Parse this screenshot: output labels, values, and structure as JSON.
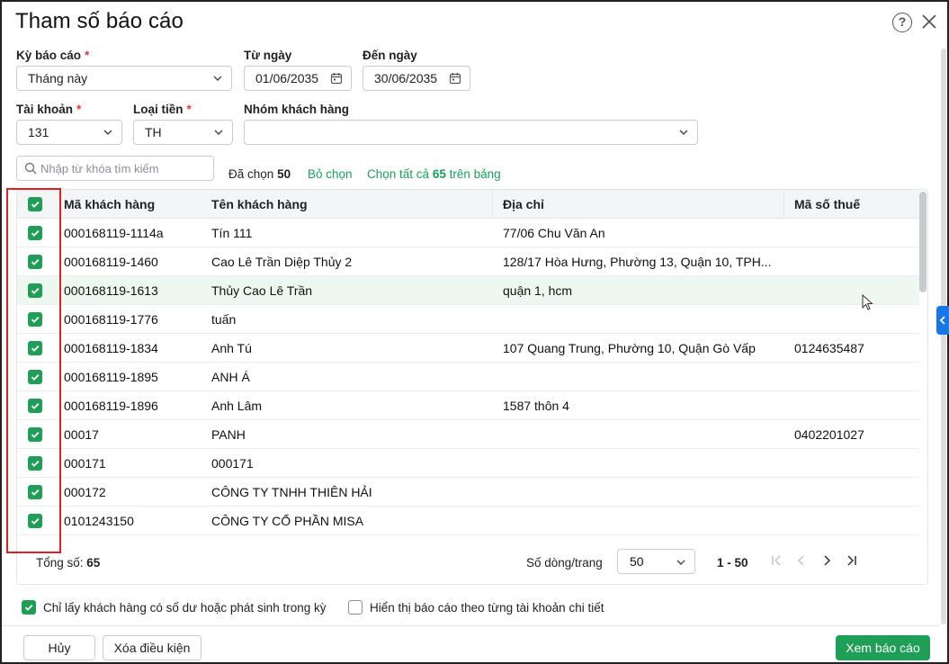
{
  "dialog": {
    "title": "Tham số báo cáo"
  },
  "filters": {
    "period_label": "Kỳ báo cáo",
    "period_value": "Tháng này",
    "from_label": "Từ ngày",
    "from_value": "01/06/2035",
    "to_label": "Đến ngày",
    "to_value": "30/06/2035",
    "account_label": "Tài khoản",
    "account_value": "131",
    "currency_label": "Loại tiền",
    "currency_value": "TH",
    "group_label": "Nhóm khách hàng",
    "group_value": "",
    "required_mark": "*"
  },
  "search": {
    "placeholder": "Nhập từ khóa tìm kiếm"
  },
  "selection": {
    "selected_prefix": "Đã chọn",
    "selected_count": "50",
    "deselect_label": "Bỏ chọn",
    "select_all_prefix": "Chọn tất cả",
    "select_all_count": "65",
    "select_all_suffix": "trên bảng"
  },
  "table": {
    "columns": [
      "Mã khách hàng",
      "Tên khách hàng",
      "Địa chỉ",
      "Mã số thuế"
    ],
    "rows": [
      {
        "code": "000168119-1114a",
        "name": "Tín 111",
        "address": "77/06 Chu Văn An",
        "tax": ""
      },
      {
        "code": "000168119-1460",
        "name": "Cao Lê Trần Diệp Thủy 2",
        "address": "128/17 Hòa Hưng, Phường 13, Quận 10, TPH...",
        "tax": ""
      },
      {
        "code": "000168119-1613",
        "name": "Thủy Cao Lê Trần",
        "address": "quận 1, hcm",
        "tax": ""
      },
      {
        "code": "000168119-1776",
        "name": "tuấn",
        "address": "",
        "tax": ""
      },
      {
        "code": "000168119-1834",
        "name": "Anh Tú",
        "address": "107 Quang Trung, Phường 10, Quận Gò Vấp",
        "tax": "0124635487"
      },
      {
        "code": "000168119-1895",
        "name": "ANH Á",
        "address": "",
        "tax": ""
      },
      {
        "code": "000168119-1896",
        "name": "Anh Lâm",
        "address": "1587 thôn 4",
        "tax": ""
      },
      {
        "code": "00017",
        "name": "PANH",
        "address": "",
        "tax": "0402201027"
      },
      {
        "code": "000171",
        "name": "000171",
        "address": "",
        "tax": ""
      },
      {
        "code": "000172",
        "name": "CÔNG TY TNHH THIÊN HẢI",
        "address": "",
        "tax": ""
      },
      {
        "code": "0101243150",
        "name": "CÔNG TY CỔ PHẦN MISA",
        "address": "",
        "tax": ""
      }
    ],
    "highlighted_row": 2
  },
  "footer": {
    "total_label": "Tổng số:",
    "total_value": "65",
    "rows_per_page_label": "Số dòng/trang",
    "rows_per_page_value": "50",
    "range": "1 - 50"
  },
  "options": {
    "only_with_balance": "Chỉ lấy khách hàng có số dư hoặc phát sinh trong kỳ",
    "by_detail_account": "Hiển thị báo cáo theo từng tài khoản chi tiết"
  },
  "buttons": {
    "cancel": "Hủy",
    "clear": "Xóa điều kiện",
    "view": "Xem báo cáo"
  },
  "colors": {
    "accent": "#1e9e57",
    "highlight_box": "#e02020",
    "side_tab": "#1677e6"
  }
}
